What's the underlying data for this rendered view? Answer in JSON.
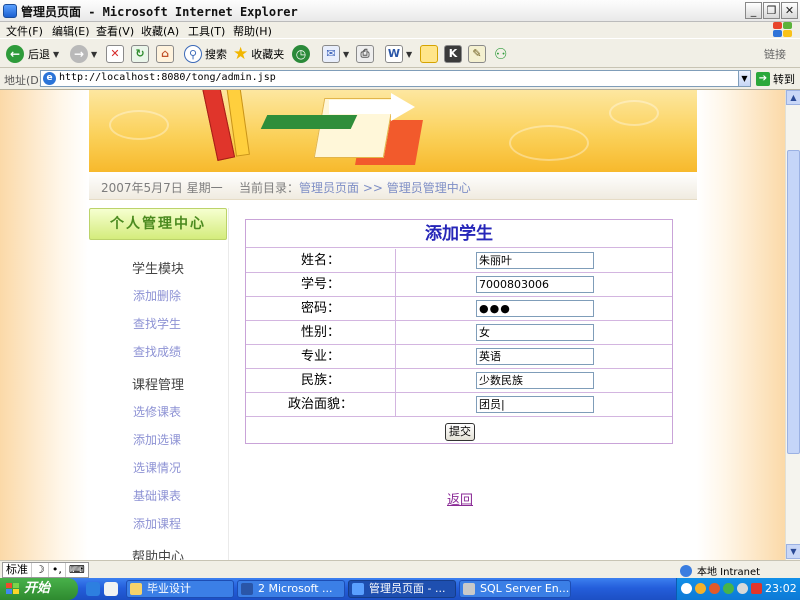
{
  "window": {
    "title": "管理员页面 - Microsoft Internet Explorer",
    "min_label": "_",
    "max_label": "❐",
    "close_label": "✕"
  },
  "menu": [
    "文件(F)",
    "编辑(E)",
    "查看(V)",
    "收藏(A)",
    "工具(T)",
    "帮助(H)"
  ],
  "toolbar": {
    "back_label": "后退",
    "search_label": "搜索",
    "favorites_label": "收藏夹",
    "links_label": "链接"
  },
  "address": {
    "label": "地址(D)",
    "url": "http://localhost:8080/tong/admin.jsp",
    "go_label": "转到"
  },
  "page": {
    "date": "2007年5月7日  星期一",
    "path_prefix": "当前目录：",
    "path_link1": "管理员页面",
    "path_sep": " >> ",
    "path_link2": "管理员管理中心"
  },
  "sidebar": {
    "header": "个人管理中心",
    "sections": [
      {
        "title": "学生模块",
        "links": [
          "添加删除",
          "查找学生",
          "查找成绩"
        ]
      },
      {
        "title": "课程管理",
        "links": [
          "选修课表",
          "添加选课",
          "选课情况",
          "基础课表",
          "添加课程"
        ]
      },
      {
        "title": "帮助中心",
        "links": []
      }
    ]
  },
  "form": {
    "title": "添加学生",
    "fields": [
      {
        "label": "姓名：",
        "value": "朱丽叶"
      },
      {
        "label": "学号：",
        "value": "7000803006"
      },
      {
        "label": "密码：",
        "value": "●●●"
      },
      {
        "label": "性别：",
        "value": "女"
      },
      {
        "label": "专业：",
        "value": "英语"
      },
      {
        "label": "民族：",
        "value": "少数民族"
      },
      {
        "label": "政治面貌：",
        "value": "团员|"
      }
    ],
    "submit_label": "提交",
    "back_label": "返回"
  },
  "statusbar": {
    "zone": "本地 Intranet",
    "ime": [
      "标准",
      "☽",
      "•,",
      "⌨"
    ]
  },
  "taskbar": {
    "start_label": "开始",
    "tasks": [
      {
        "label": "毕业设计",
        "active": false
      },
      {
        "label": "2 Microsoft ...",
        "active": false
      },
      {
        "label": "管理员页面 - ...",
        "active": true
      },
      {
        "label": "SQL Server En...",
        "active": false
      }
    ],
    "clock": "23:02"
  },
  "colors": {
    "link_purple": "#8d92d4",
    "form_title_blue": "#2626b8",
    "form_border": "#c9a3d8",
    "sidebar_header_green": "#4b8a1f",
    "taskbar_blue": "#245edb",
    "start_green": "#2e8a2f"
  }
}
